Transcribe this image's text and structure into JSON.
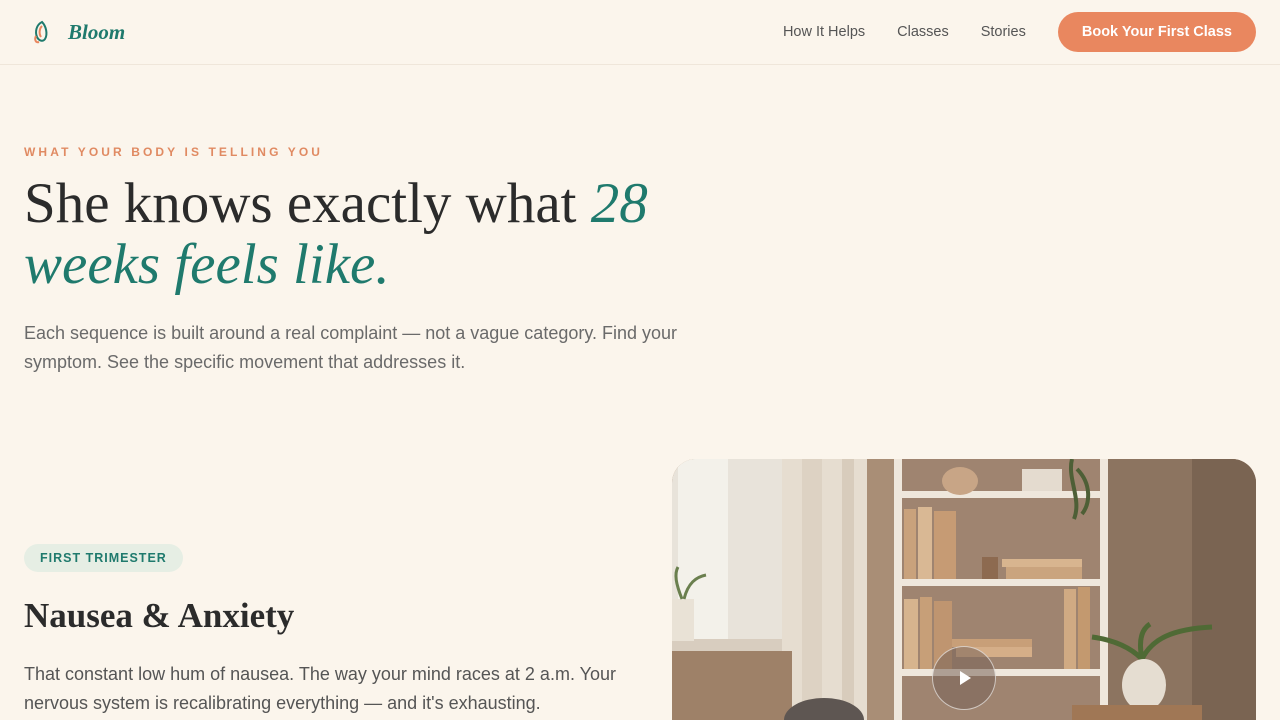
{
  "brand": {
    "name": "Bloom",
    "icon": "bloom-leaf-icon"
  },
  "nav": {
    "links": [
      "How It Helps",
      "Classes",
      "Stories"
    ],
    "cta_label": "Book Your First Class"
  },
  "hero": {
    "eyebrow": "WHAT YOUR BODY IS TELLING YOU",
    "headline_plain": "She knows exactly what ",
    "headline_accent": "28 weeks feels like.",
    "subcopy": "Each sequence is built around a real complaint — not a vague category. Find your symptom. See the specific movement that addresses it."
  },
  "symptom": {
    "badge": "FIRST TRIMESTER",
    "title": "Nausea & Anxiety",
    "body": "That constant low hum of nausea. The way your mind races at 2 a.m. Your nervous system is recalibrating everything — and it's exhausting.",
    "media_icon": "play-icon"
  },
  "colors": {
    "background": "#fbf5ec",
    "brand_teal": "#1f7a6d",
    "accent_orange": "#e9875f",
    "badge_bg": "#e6eee4"
  }
}
